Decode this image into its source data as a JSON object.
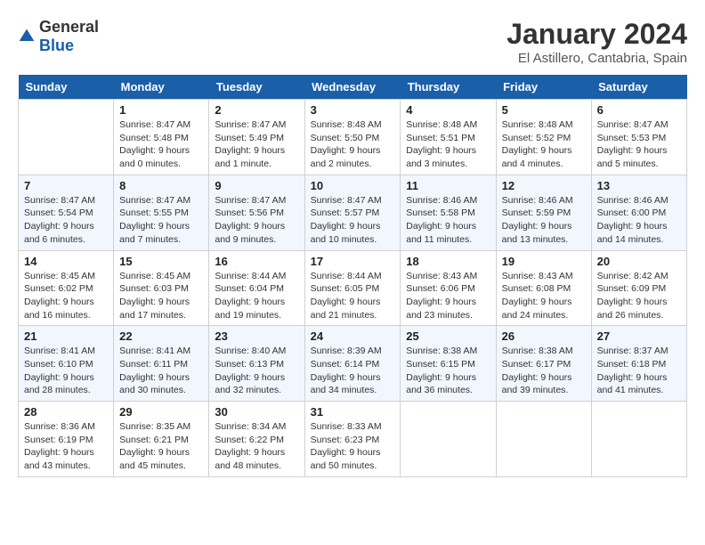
{
  "header": {
    "logo_general": "General",
    "logo_blue": "Blue",
    "title": "January 2024",
    "subtitle": "El Astillero, Cantabria, Spain"
  },
  "calendar": {
    "days_of_week": [
      "Sunday",
      "Monday",
      "Tuesday",
      "Wednesday",
      "Thursday",
      "Friday",
      "Saturday"
    ],
    "weeks": [
      [
        {
          "day": "",
          "info": ""
        },
        {
          "day": "1",
          "info": "Sunrise: 8:47 AM\nSunset: 5:48 PM\nDaylight: 9 hours\nand 0 minutes."
        },
        {
          "day": "2",
          "info": "Sunrise: 8:47 AM\nSunset: 5:49 PM\nDaylight: 9 hours\nand 1 minute."
        },
        {
          "day": "3",
          "info": "Sunrise: 8:48 AM\nSunset: 5:50 PM\nDaylight: 9 hours\nand 2 minutes."
        },
        {
          "day": "4",
          "info": "Sunrise: 8:48 AM\nSunset: 5:51 PM\nDaylight: 9 hours\nand 3 minutes."
        },
        {
          "day": "5",
          "info": "Sunrise: 8:48 AM\nSunset: 5:52 PM\nDaylight: 9 hours\nand 4 minutes."
        },
        {
          "day": "6",
          "info": "Sunrise: 8:47 AM\nSunset: 5:53 PM\nDaylight: 9 hours\nand 5 minutes."
        }
      ],
      [
        {
          "day": "7",
          "info": "Sunrise: 8:47 AM\nSunset: 5:54 PM\nDaylight: 9 hours\nand 6 minutes."
        },
        {
          "day": "8",
          "info": "Sunrise: 8:47 AM\nSunset: 5:55 PM\nDaylight: 9 hours\nand 7 minutes."
        },
        {
          "day": "9",
          "info": "Sunrise: 8:47 AM\nSunset: 5:56 PM\nDaylight: 9 hours\nand 9 minutes."
        },
        {
          "day": "10",
          "info": "Sunrise: 8:47 AM\nSunset: 5:57 PM\nDaylight: 9 hours\nand 10 minutes."
        },
        {
          "day": "11",
          "info": "Sunrise: 8:46 AM\nSunset: 5:58 PM\nDaylight: 9 hours\nand 11 minutes."
        },
        {
          "day": "12",
          "info": "Sunrise: 8:46 AM\nSunset: 5:59 PM\nDaylight: 9 hours\nand 13 minutes."
        },
        {
          "day": "13",
          "info": "Sunrise: 8:46 AM\nSunset: 6:00 PM\nDaylight: 9 hours\nand 14 minutes."
        }
      ],
      [
        {
          "day": "14",
          "info": "Sunrise: 8:45 AM\nSunset: 6:02 PM\nDaylight: 9 hours\nand 16 minutes."
        },
        {
          "day": "15",
          "info": "Sunrise: 8:45 AM\nSunset: 6:03 PM\nDaylight: 9 hours\nand 17 minutes."
        },
        {
          "day": "16",
          "info": "Sunrise: 8:44 AM\nSunset: 6:04 PM\nDaylight: 9 hours\nand 19 minutes."
        },
        {
          "day": "17",
          "info": "Sunrise: 8:44 AM\nSunset: 6:05 PM\nDaylight: 9 hours\nand 21 minutes."
        },
        {
          "day": "18",
          "info": "Sunrise: 8:43 AM\nSunset: 6:06 PM\nDaylight: 9 hours\nand 23 minutes."
        },
        {
          "day": "19",
          "info": "Sunrise: 8:43 AM\nSunset: 6:08 PM\nDaylight: 9 hours\nand 24 minutes."
        },
        {
          "day": "20",
          "info": "Sunrise: 8:42 AM\nSunset: 6:09 PM\nDaylight: 9 hours\nand 26 minutes."
        }
      ],
      [
        {
          "day": "21",
          "info": "Sunrise: 8:41 AM\nSunset: 6:10 PM\nDaylight: 9 hours\nand 28 minutes."
        },
        {
          "day": "22",
          "info": "Sunrise: 8:41 AM\nSunset: 6:11 PM\nDaylight: 9 hours\nand 30 minutes."
        },
        {
          "day": "23",
          "info": "Sunrise: 8:40 AM\nSunset: 6:13 PM\nDaylight: 9 hours\nand 32 minutes."
        },
        {
          "day": "24",
          "info": "Sunrise: 8:39 AM\nSunset: 6:14 PM\nDaylight: 9 hours\nand 34 minutes."
        },
        {
          "day": "25",
          "info": "Sunrise: 8:38 AM\nSunset: 6:15 PM\nDaylight: 9 hours\nand 36 minutes."
        },
        {
          "day": "26",
          "info": "Sunrise: 8:38 AM\nSunset: 6:17 PM\nDaylight: 9 hours\nand 39 minutes."
        },
        {
          "day": "27",
          "info": "Sunrise: 8:37 AM\nSunset: 6:18 PM\nDaylight: 9 hours\nand 41 minutes."
        }
      ],
      [
        {
          "day": "28",
          "info": "Sunrise: 8:36 AM\nSunset: 6:19 PM\nDaylight: 9 hours\nand 43 minutes."
        },
        {
          "day": "29",
          "info": "Sunrise: 8:35 AM\nSunset: 6:21 PM\nDaylight: 9 hours\nand 45 minutes."
        },
        {
          "day": "30",
          "info": "Sunrise: 8:34 AM\nSunset: 6:22 PM\nDaylight: 9 hours\nand 48 minutes."
        },
        {
          "day": "31",
          "info": "Sunrise: 8:33 AM\nSunset: 6:23 PM\nDaylight: 9 hours\nand 50 minutes."
        },
        {
          "day": "",
          "info": ""
        },
        {
          "day": "",
          "info": ""
        },
        {
          "day": "",
          "info": ""
        }
      ]
    ]
  }
}
